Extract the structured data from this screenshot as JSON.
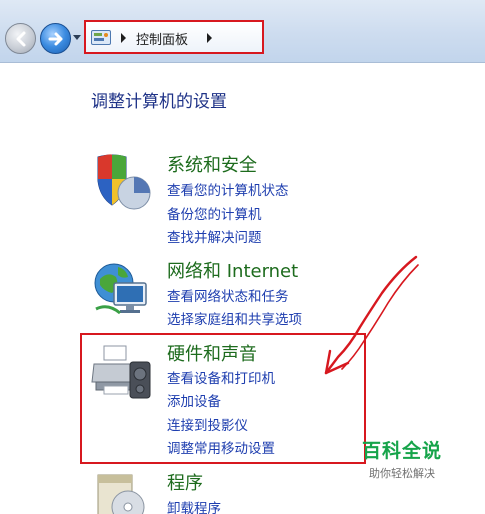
{
  "breadcrumb": {
    "current": "控制面板"
  },
  "page": {
    "title": "调整计算机的设置"
  },
  "categories": [
    {
      "title": "系统和安全",
      "icon": "shield-pie-icon",
      "links": [
        "查看您的计算机状态",
        "备份您的计算机",
        "查找并解决问题"
      ]
    },
    {
      "title": "网络和 Internet",
      "icon": "globe-network-icon",
      "links": [
        "查看网络状态和任务",
        "选择家庭组和共享选项"
      ]
    },
    {
      "title": "硬件和声音",
      "icon": "printer-speaker-icon",
      "links": [
        "查看设备和打印机",
        "添加设备",
        "连接到投影仪",
        "调整常用移动设置"
      ]
    },
    {
      "title": "程序",
      "icon": "program-disc-icon",
      "links": [
        "卸载程序"
      ]
    }
  ],
  "watermark": {
    "main": "百科全说",
    "sub": "助你轻松解决"
  },
  "colors": {
    "category_title": "#1d6b1d",
    "link": "#1e3eaf",
    "page_title": "#1e3287",
    "highlight": "#d7181f",
    "watermark": "#16a44a"
  }
}
